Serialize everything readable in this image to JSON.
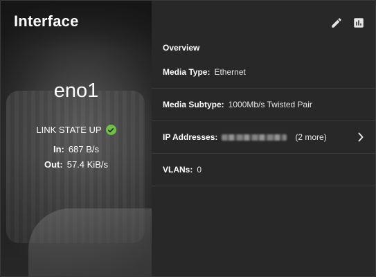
{
  "card": {
    "title": "Interface",
    "interface_name": "eno1",
    "link_state": "LINK STATE UP",
    "traffic": {
      "in_label": "In:",
      "in_value": "687 B/s",
      "out_label": "Out:",
      "out_value": "57.4 KiB/s"
    },
    "actions": {
      "edit_icon": "pencil-icon",
      "chart_icon": "bar-chart-icon"
    }
  },
  "overview": {
    "heading": "Overview",
    "media_type_label": "Media Type:",
    "media_type_value": "Ethernet",
    "media_subtype_label": "Media Subtype:",
    "media_subtype_value": "1000Mb/s Twisted Pair",
    "ip_label": "IP Addresses:",
    "ip_more": "(2 more)",
    "vlans_label": "VLANs:",
    "vlans_value": "0"
  },
  "colors": {
    "status_ok": "#71bf44",
    "panel_bg": "#282828",
    "divider": "#3a3a3a"
  }
}
